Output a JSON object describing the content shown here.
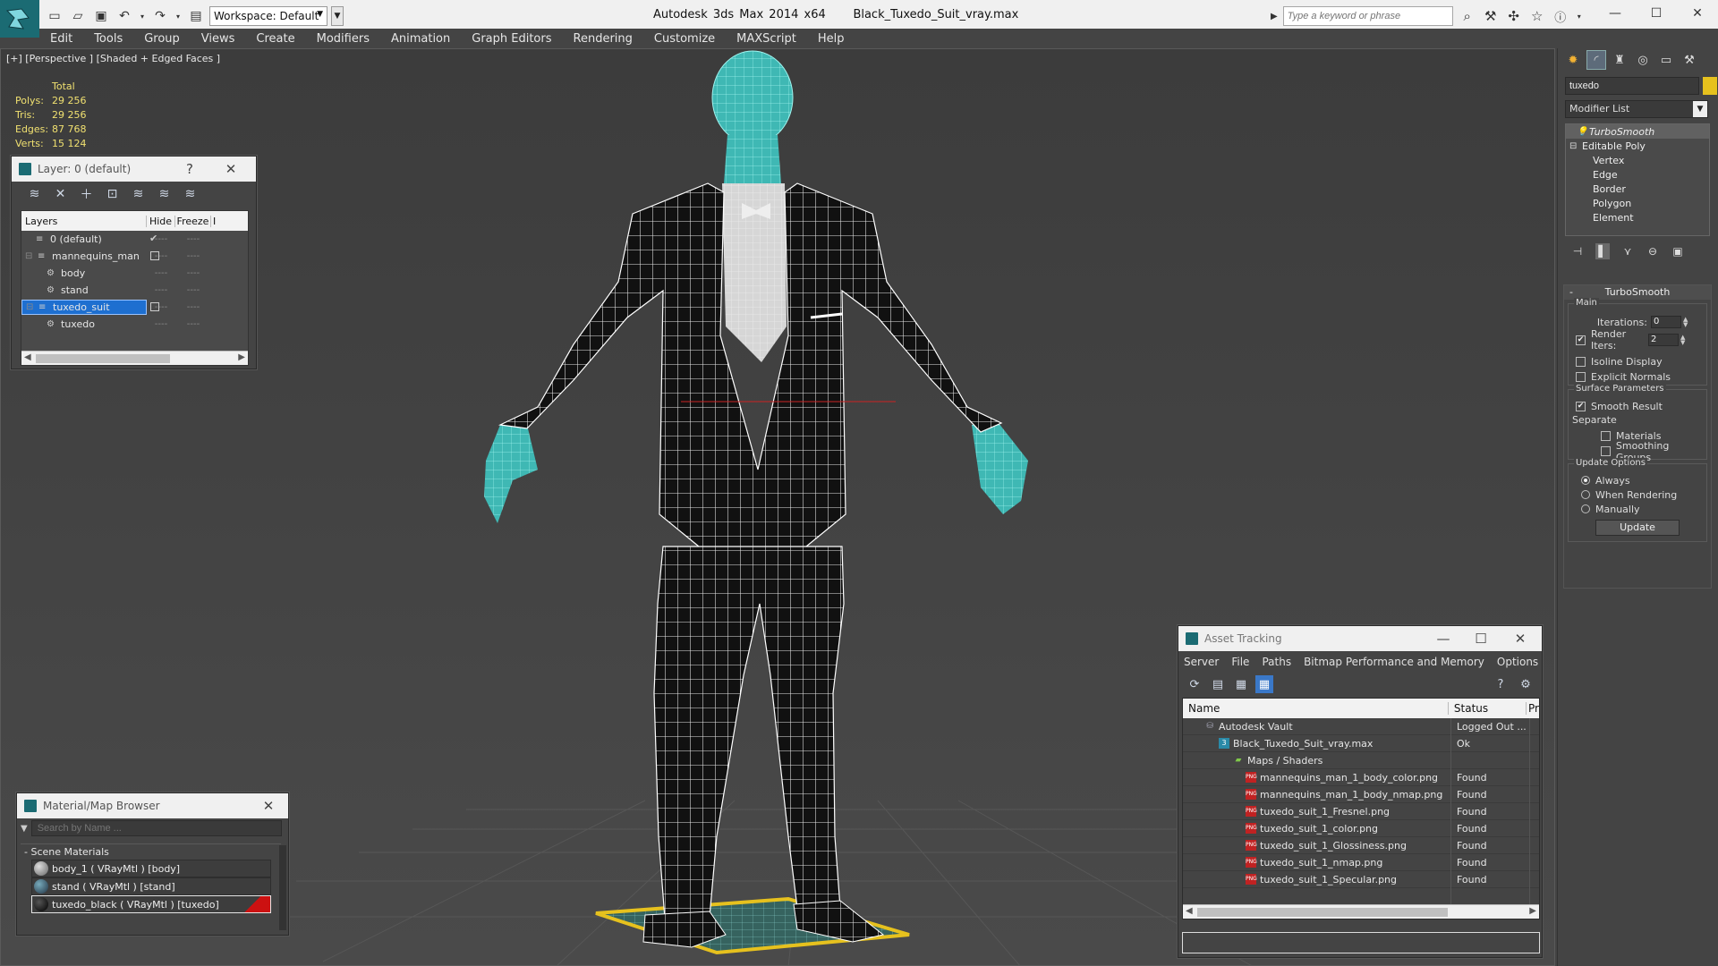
{
  "titlebar": {
    "workspace_label": "Workspace: Default",
    "app_name": "Autodesk 3ds Max  2014 x64",
    "file_name": "Black_Tuxedo_Suit_vray.max",
    "search_placeholder": "Type a keyword or phrase"
  },
  "menu": [
    "Edit",
    "Tools",
    "Group",
    "Views",
    "Create",
    "Modifiers",
    "Animation",
    "Graph Editors",
    "Rendering",
    "Customize",
    "MAXScript",
    "Help"
  ],
  "viewport": {
    "label": "[+] [Perspective ] [Shaded + Edged Faces ]",
    "stats": {
      "header": "Total",
      "rows": [
        {
          "key": "Polys:",
          "value": "29 256"
        },
        {
          "key": "Tris:",
          "value": "29 256"
        },
        {
          "key": "Edges:",
          "value": "87 768"
        },
        {
          "key": "Verts:",
          "value": "15 124"
        }
      ]
    }
  },
  "layer_dialog": {
    "title": "Layer: 0 (default)",
    "help": "?",
    "columns": {
      "name": "Layers",
      "hide": "Hide",
      "freeze": "Freeze",
      "extra": "I"
    },
    "rows": [
      {
        "name": "0 (default)",
        "dash": "----"
      },
      {
        "name": "mannequins_man",
        "dash": "----"
      },
      {
        "name": "body",
        "dash": "----"
      },
      {
        "name": "stand",
        "dash": "----"
      },
      {
        "name": "tuxedo_suit",
        "dash": "----"
      },
      {
        "name": "tuxedo",
        "dash": "----"
      }
    ]
  },
  "material_browser": {
    "title": "Material/Map Browser",
    "search_placeholder": "Search by Name ...",
    "group": "- Scene Materials",
    "items": [
      {
        "label": "body_1  ( VRayMtl ) [body]"
      },
      {
        "label": "stand  ( VRayMtl ) [stand]"
      },
      {
        "label": "tuxedo_black  ( VRayMtl ) [tuxedo]"
      }
    ]
  },
  "asset_tracking": {
    "title": "Asset Tracking",
    "menu": [
      "Server",
      "File",
      "Paths",
      "Bitmap Performance and Memory",
      "Options"
    ],
    "columns": {
      "name": "Name",
      "status": "Status",
      "extra": "Pr"
    },
    "rows": [
      {
        "name": "Autodesk Vault",
        "status": "Logged Out ...",
        "icon": "vault-icon",
        "ico": "⛁",
        "indent": 24
      },
      {
        "name": "Black_Tuxedo_Suit_vray.max",
        "status": "Ok",
        "icon": "max-file-icon",
        "ico": "3",
        "indent": 40
      },
      {
        "name": "Maps / Shaders",
        "status": "",
        "icon": "folder-icon",
        "ico": "▰",
        "indent": 56
      },
      {
        "name": "mannequins_man_1_body_color.png",
        "status": "Found",
        "icon": "png-icon",
        "ico": "PNG",
        "indent": 70
      },
      {
        "name": "mannequins_man_1_body_nmap.png",
        "status": "Found",
        "icon": "png-icon",
        "ico": "PNG",
        "indent": 70
      },
      {
        "name": "tuxedo_suit_1_Fresnel.png",
        "status": "Found",
        "icon": "png-icon",
        "ico": "PNG",
        "indent": 70
      },
      {
        "name": "tuxedo_suit_1_color.png",
        "status": "Found",
        "icon": "png-icon",
        "ico": "PNG",
        "indent": 70
      },
      {
        "name": "tuxedo_suit_1_Glossiness.png",
        "status": "Found",
        "icon": "png-icon",
        "ico": "PNG",
        "indent": 70
      },
      {
        "name": "tuxedo_suit_1_nmap.png",
        "status": "Found",
        "icon": "png-icon",
        "ico": "PNG",
        "indent": 70
      },
      {
        "name": "tuxedo_suit_1_Specular.png",
        "status": "Found",
        "icon": "png-icon",
        "ico": "PNG",
        "indent": 70
      }
    ]
  },
  "command_panel": {
    "object_name": "tuxedo",
    "object_color": "#e6c11e",
    "modifier_list": "Modifier List",
    "stack": {
      "top": "TurboSmooth",
      "parent": "Editable Poly",
      "children": [
        "Vertex",
        "Edge",
        "Border",
        "Polygon",
        "Element"
      ]
    },
    "turbosmooth": {
      "title": "TurboSmooth",
      "main_label": "Main",
      "iterations_label": "Iterations:",
      "iterations_value": "0",
      "render_iters_label": "Render Iters:",
      "render_iters_value": "2",
      "render_iters_checked": true,
      "isoline_label": "Isoline Display",
      "explicit_label": "Explicit Normals",
      "surface_label": "Surface Parameters",
      "smooth_result_label": "Smooth Result",
      "smooth_result_checked": true,
      "separate_label": "Separate",
      "materials_label": "Materials",
      "smoothing_groups_label": "Smoothing Groups",
      "update_options_label": "Update Options",
      "radio_always": "Always",
      "radio_when_rendering": "When Rendering",
      "radio_manually": "Manually",
      "selected_update": "Always",
      "update_button": "Update"
    }
  },
  "colors": {
    "accent": "#1e6fd0",
    "wire_suit": "#ffffff",
    "wire_body": "#40e0d0",
    "stand": "#e6c11e",
    "material_marker": "#cc1111"
  }
}
